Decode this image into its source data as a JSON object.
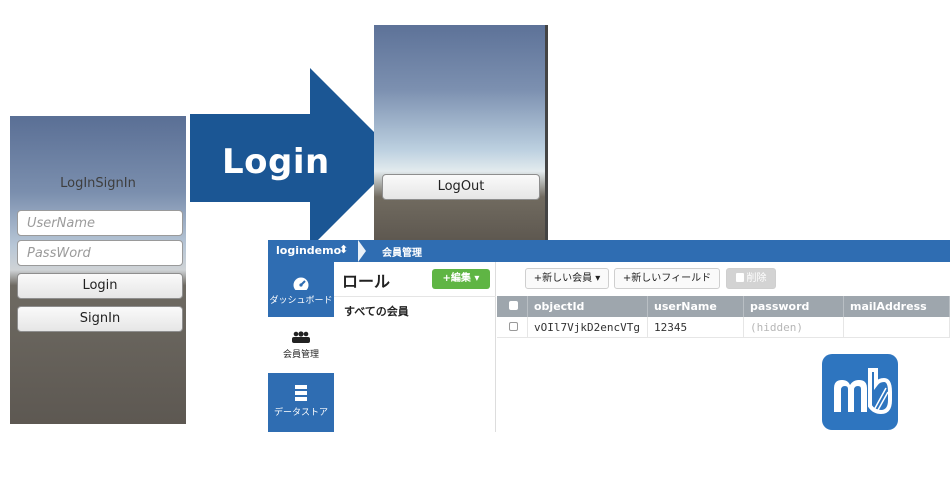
{
  "login_screen": {
    "title": "LogInSignIn",
    "username_placeholder": "UserName",
    "password_placeholder": "PassWord",
    "login_button": "Login",
    "signin_button": "SignIn"
  },
  "arrow": {
    "label": "Login",
    "color": "#1b5694"
  },
  "logout_screen": {
    "logout_button": "LogOut"
  },
  "console": {
    "app_name": "logindemo",
    "app_switch_icon": "updown-caret-icon",
    "breadcrumb": "会員管理",
    "brand_color": "#2f6db2",
    "sidebar": [
      {
        "label": "ダッシュボード",
        "icon": "speedometer-icon",
        "active": false
      },
      {
        "label": "会員管理",
        "icon": "users-icon",
        "active": true
      },
      {
        "label": "データストア",
        "icon": "database-icon",
        "active": false
      }
    ],
    "roles": {
      "heading": "ロール",
      "edit_button": "+編集 ▾",
      "all_members": "すべての会員"
    },
    "toolbar": {
      "new_member": "+新しい会員 ▾",
      "new_field": "+新しいフィールド",
      "delete": "削除"
    },
    "table": {
      "columns": [
        "objectId",
        "userName",
        "password",
        "mailAddress"
      ],
      "rows": [
        {
          "objectId": "vOIl7VjkD2encVTg",
          "userName": "12345",
          "password": "(hidden)",
          "mailAddress": ""
        }
      ]
    }
  },
  "logo": {
    "text": "mb",
    "color": "#2e75bf"
  }
}
